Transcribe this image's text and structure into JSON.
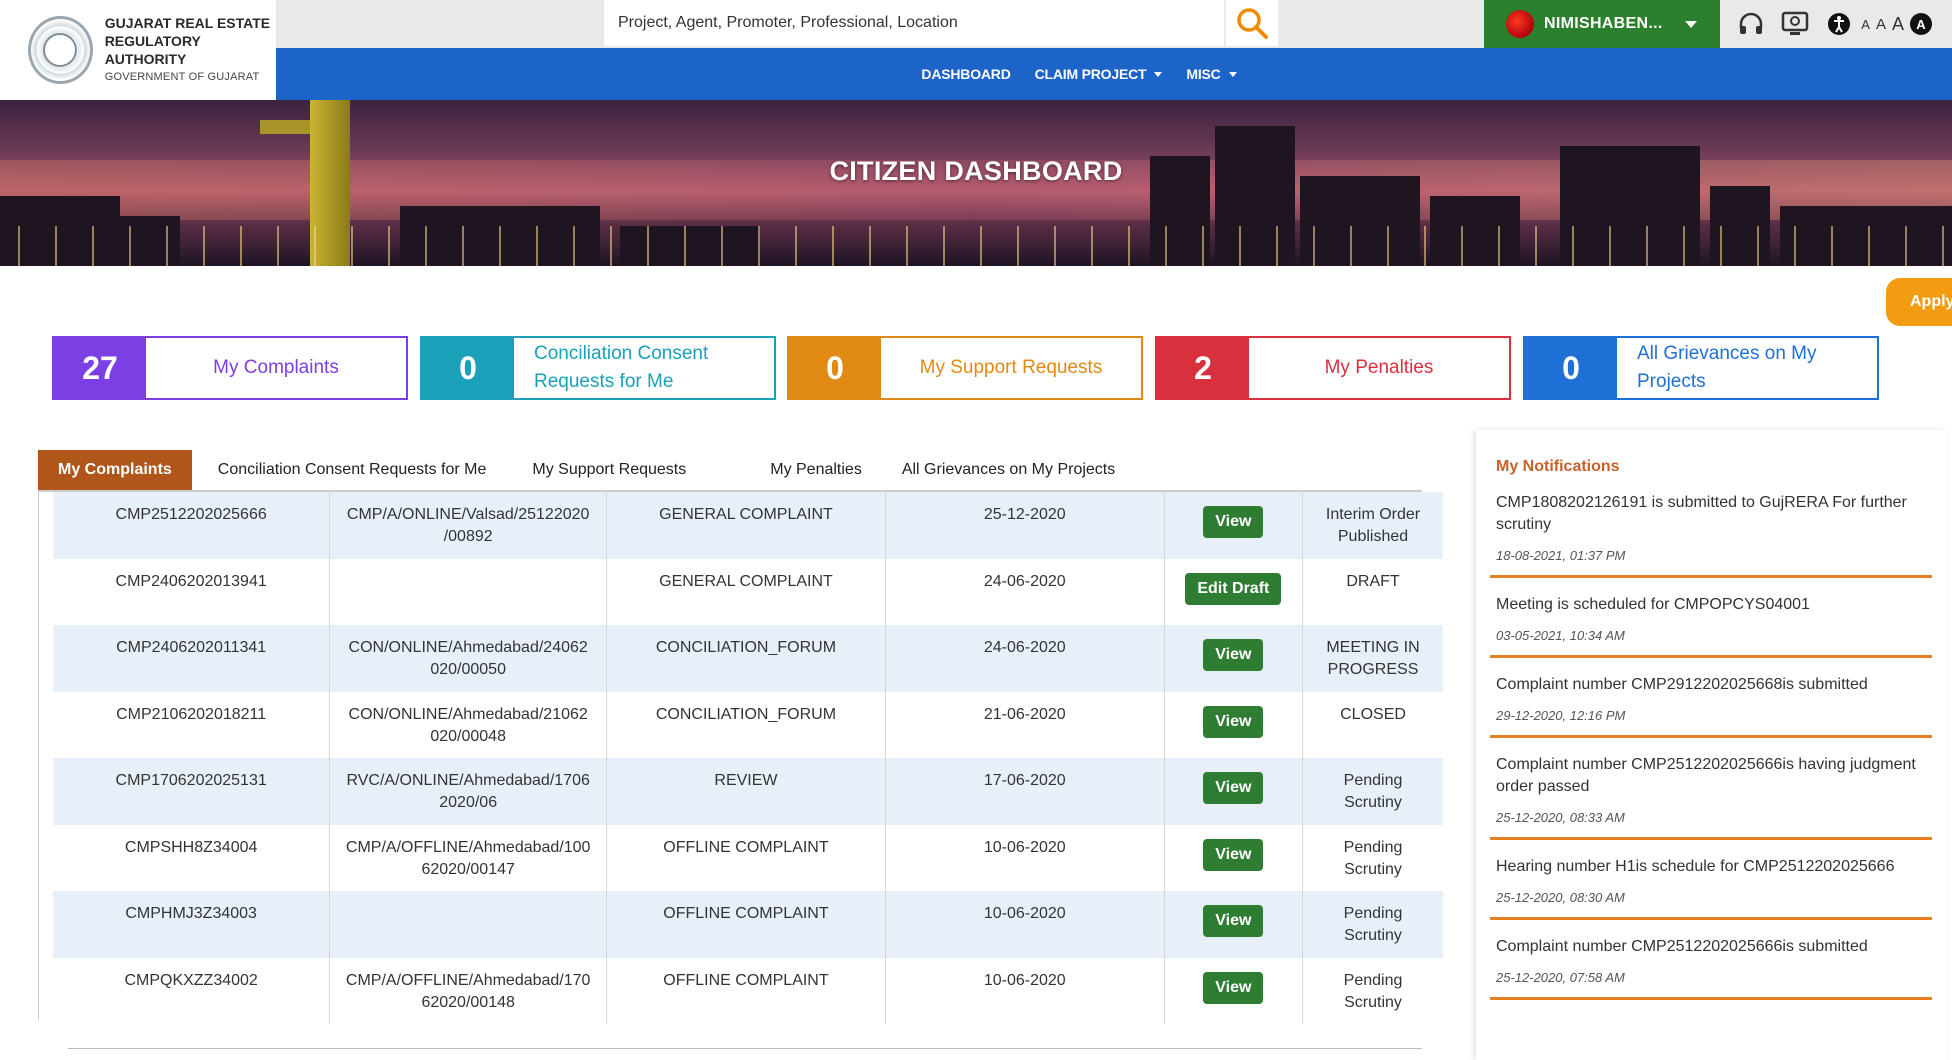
{
  "header": {
    "logo_line1": "GUJARAT REAL ESTATE",
    "logo_line2": "REGULATORY AUTHORITY",
    "logo_line3": "GOVERNMENT OF GUJARAT",
    "search_placeholder": "Project, Agent, Promoter, Professional, Location",
    "user_name": "NIMISHABEN...",
    "font_small": "A",
    "font_medium": "A",
    "font_large": "A",
    "contrast_label": "A"
  },
  "nav": {
    "dashboard": "DASHBOARD",
    "claim_project": "CLAIM PROJECT",
    "misc": "MISC"
  },
  "banner": {
    "title": "CITIZEN DASHBOARD"
  },
  "apply_label": "Apply",
  "stats": [
    {
      "count": "27",
      "label": "My Complaints",
      "color": "#7b3fe4"
    },
    {
      "count": "0",
      "label": "Conciliation Consent Requests for Me",
      "color": "#1aa0b8"
    },
    {
      "count": "0",
      "label": "My Support Requests",
      "color": "#e08a15"
    },
    {
      "count": "2",
      "label": "My Penalties",
      "color": "#d9303e"
    },
    {
      "count": "0",
      "label": "All Grievances on My Projects",
      "color": "#1e6fd6"
    }
  ],
  "tabs": [
    "My Complaints",
    "Conciliation Consent Requests for Me",
    "My Support Requests",
    "My Penalties",
    "All Grievances on My Projects"
  ],
  "complaints": [
    {
      "id": "CMP2512202025666",
      "ref": "CMP/A/ONLINE/Valsad/25122020\n/00892",
      "type": "GENERAL COMPLAINT",
      "date": "25-12-2020",
      "action": "View",
      "status": "Interim Order\nPublished"
    },
    {
      "id": "CMP2406202013941",
      "ref": "",
      "type": "GENERAL COMPLAINT",
      "date": "24-06-2020",
      "action": "Edit Draft",
      "status": "DRAFT"
    },
    {
      "id": "CMP2406202011341",
      "ref": "CON/ONLINE/Ahmedabad/24062\n020/00050",
      "type": "CONCILIATION_FORUM",
      "date": "24-06-2020",
      "action": "View",
      "status": "MEETING IN\nPROGRESS"
    },
    {
      "id": "CMP2106202018211",
      "ref": "CON/ONLINE/Ahmedabad/21062\n020/00048",
      "type": "CONCILIATION_FORUM",
      "date": "21-06-2020",
      "action": "View",
      "status": "CLOSED"
    },
    {
      "id": "CMP1706202025131",
      "ref": "RVC/A/ONLINE/Ahmedabad/1706\n2020/06",
      "type": "REVIEW",
      "date": "17-06-2020",
      "action": "View",
      "status": "Pending\nScrutiny"
    },
    {
      "id": "CMPSHH8Z34004",
      "ref": "CMP/A/OFFLINE/Ahmedabad/100\n62020/00147",
      "type": "OFFLINE COMPLAINT",
      "date": "10-06-2020",
      "action": "View",
      "status": "Pending\nScrutiny"
    },
    {
      "id": "CMPHMJ3Z34003",
      "ref": "",
      "type": "OFFLINE COMPLAINT",
      "date": "10-06-2020",
      "action": "View",
      "status": "Pending\nScrutiny"
    },
    {
      "id": "CMPQKXZZ34002",
      "ref": "CMP/A/OFFLINE/Ahmedabad/170\n62020/00148",
      "type": "OFFLINE COMPLAINT",
      "date": "10-06-2020",
      "action": "View",
      "status": "Pending\nScrutiny"
    }
  ],
  "notifications": {
    "title": "My Notifications",
    "items": [
      {
        "text": "CMP1808202126191 is submitted to GujRERA For further scrutiny",
        "time": "18-08-2021, 01:37 PM"
      },
      {
        "text": "Meeting is scheduled for CMPOPCYS04001",
        "time": "03-05-2021, 10:34 AM"
      },
      {
        "text": "Complaint number CMP2912202025668is submitted",
        "time": "29-12-2020, 12:16 PM"
      },
      {
        "text": "Complaint number CMP2512202025666is having judgment order passed",
        "time": "25-12-2020, 08:33 AM"
      },
      {
        "text": "Hearing number H1is schedule for CMP2512202025666",
        "time": "25-12-2020, 08:30 AM"
      },
      {
        "text": "Complaint number CMP2512202025666is submitted",
        "time": "25-12-2020, 07:58 AM"
      }
    ]
  }
}
